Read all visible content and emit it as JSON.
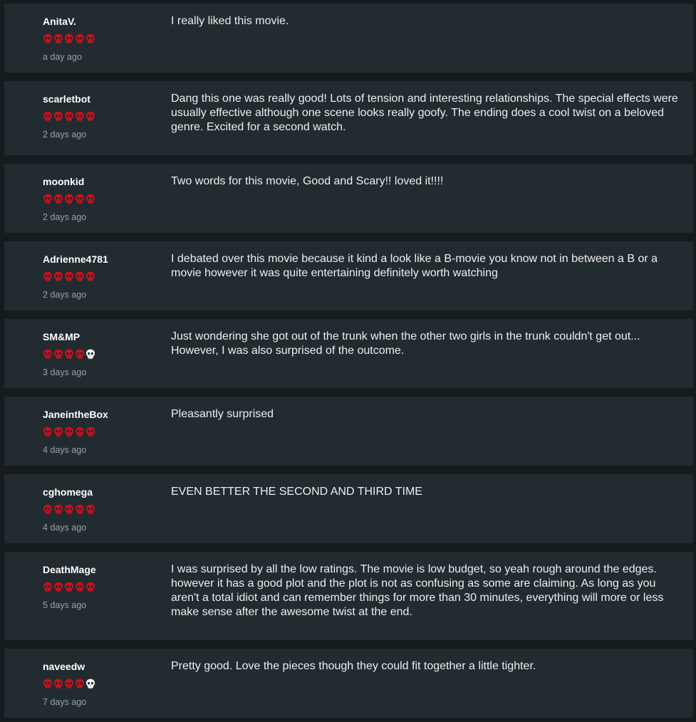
{
  "colors": {
    "background": "#161b1e",
    "card": "#222b2f",
    "skull_filled": "#c8101d",
    "skull_empty": "#ffffff",
    "username": "#ffffff",
    "time": "#9aa3a8",
    "text": "#eeeeee"
  },
  "icons": {
    "rating": "skull-icon"
  },
  "reviews": [
    {
      "username": "AnitaV.",
      "rating": 5,
      "max_rating": 5,
      "time": "a day ago",
      "text": "I really liked this movie."
    },
    {
      "username": "scarletbot",
      "rating": 5,
      "max_rating": 5,
      "time": "2 days ago",
      "text": "Dang this one was really good! Lots of tension and interesting relationships. The special effects were usually effective although one scene looks really goofy. The ending does a cool twist on a beloved genre. Excited for a second watch."
    },
    {
      "username": "moonkid",
      "rating": 5,
      "max_rating": 5,
      "time": "2 days ago",
      "text": "Two words for this movie, Good and Scary!! loved it!!!!"
    },
    {
      "username": "Adrienne4781",
      "rating": 5,
      "max_rating": 5,
      "time": "2 days ago",
      "text": "I debated over this movie because it kind a look like a B-movie you know not in between a B or a movie however it was quite entertaining definitely worth watching"
    },
    {
      "username": "SM&MP",
      "rating": 4,
      "max_rating": 5,
      "time": "3 days ago",
      "text": "Just wondering she got out of the trunk when the other two girls in the trunk couldn't get out... However, I was also surprised of the outcome."
    },
    {
      "username": "JaneintheBox",
      "rating": 5,
      "max_rating": 5,
      "time": "4 days ago",
      "text": "Pleasantly surprised"
    },
    {
      "username": "cghomega",
      "rating": 5,
      "max_rating": 5,
      "time": "4 days ago",
      "text": "EVEN BETTER THE SECOND AND THIRD TIME"
    },
    {
      "username": "DeathMage",
      "rating": 5,
      "max_rating": 5,
      "time": "5 days ago",
      "text": "I was surprised by all the low ratings. The movie is low budget, so yeah rough around the edges. however it has a good plot and the plot is not as confusing as some are claiming. As long as you aren't a total idiot and can remember things for more than 30 minutes, everything will more or less make sense after the awesome twist at the end."
    },
    {
      "username": "naveedw",
      "rating": 4,
      "max_rating": 5,
      "time": "7 days ago",
      "text": "Pretty good. Love the pieces though they could fit together a little tighter."
    }
  ]
}
